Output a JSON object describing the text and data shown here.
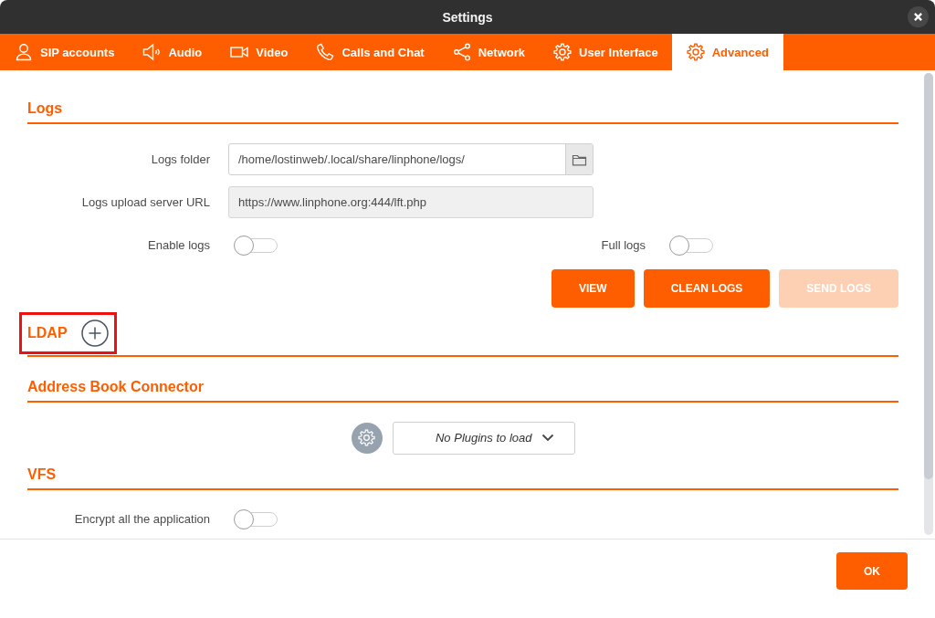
{
  "window": {
    "title": "Settings"
  },
  "tabs": [
    {
      "label": "SIP accounts",
      "selected": false
    },
    {
      "label": "Audio",
      "selected": false
    },
    {
      "label": "Video",
      "selected": false
    },
    {
      "label": "Calls and Chat",
      "selected": false
    },
    {
      "label": "Network",
      "selected": false
    },
    {
      "label": "User Interface",
      "selected": false
    },
    {
      "label": "Advanced",
      "selected": true
    }
  ],
  "logs": {
    "title": "Logs",
    "fields": [
      {
        "kind": "folder",
        "label": "Logs folder",
        "value": "/home/lostinweb/.local/share/linphone/logs/",
        "disabled": false
      },
      {
        "kind": "text",
        "label": "Logs upload server URL",
        "value": "https://www.linphone.org:444/lft.php",
        "disabled": true
      }
    ],
    "toggles": [
      {
        "label": "Enable logs",
        "on": false
      },
      {
        "label": "Full logs",
        "on": false
      }
    ],
    "buttons": [
      {
        "label": "VIEW",
        "disabled": false
      },
      {
        "label": "CLEAN LOGS",
        "disabled": false
      },
      {
        "label": "SEND LOGS",
        "disabled": true
      }
    ]
  },
  "ldap": {
    "title": "LDAP",
    "highlighted": true
  },
  "address_book_connector": {
    "title": "Address Book Connector",
    "plugins": {
      "value": "No Plugins to load"
    }
  },
  "vfs": {
    "title": "VFS",
    "toggles": [
      {
        "label": "Encrypt all the application",
        "on": false
      }
    ]
  },
  "footer": {
    "buttons": [
      {
        "label": "OK"
      }
    ]
  }
}
